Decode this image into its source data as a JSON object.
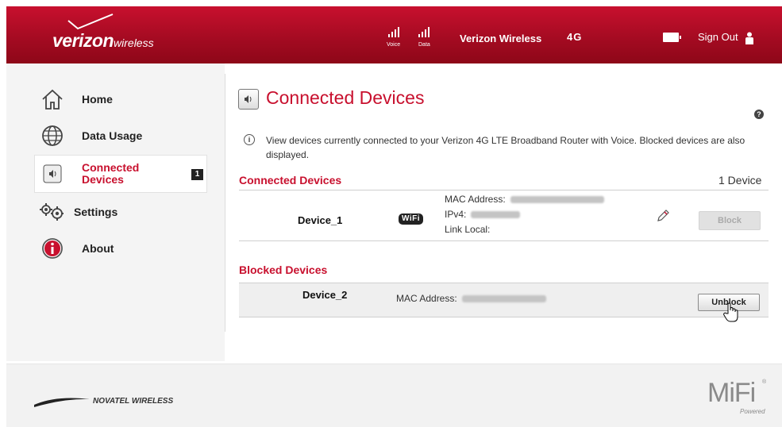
{
  "header": {
    "brand_main": "verizon",
    "brand_sub": "wireless",
    "signal_voice_label": "Voice",
    "signal_data_label": "Data",
    "carrier": "Verizon Wireless",
    "network": "4G",
    "sign_out": "Sign Out",
    "accent": "#c8102e"
  },
  "sidebar": {
    "items": [
      {
        "label": "Home",
        "icon": "home-icon"
      },
      {
        "label": "Data Usage",
        "icon": "globe-icon"
      },
      {
        "label": "Connected Devices",
        "label_line1": "Connected",
        "label_line2": "Devices",
        "icon": "speaker-icon",
        "badge": "1",
        "active": true
      },
      {
        "label": "Settings",
        "icon": "gears-icon"
      },
      {
        "label": "About",
        "icon": "info-icon"
      }
    ]
  },
  "main": {
    "title": "Connected Devices",
    "info_text": "View devices currently connected to your Verizon 4G LTE Broadband Router with Voice. Blocked devices are also displayed.",
    "connected_section": {
      "title": "Connected Devices",
      "count": "1 Device",
      "devices": [
        {
          "name": "Device_1",
          "connection": "WiFi",
          "mac_label": "MAC Address:",
          "ipv4_label": "IPv4:",
          "link_local_label": "Link Local:",
          "action": "Block"
        }
      ]
    },
    "blocked_section": {
      "title": "Blocked Devices",
      "devices": [
        {
          "name": "Device_2",
          "mac_label": "MAC Address:",
          "action": "Unblock"
        }
      ]
    }
  },
  "footer": {
    "partner": "NOVATEL WIRELESS",
    "product": "MiFi",
    "product_sub": "Powered",
    "registered": "®"
  }
}
